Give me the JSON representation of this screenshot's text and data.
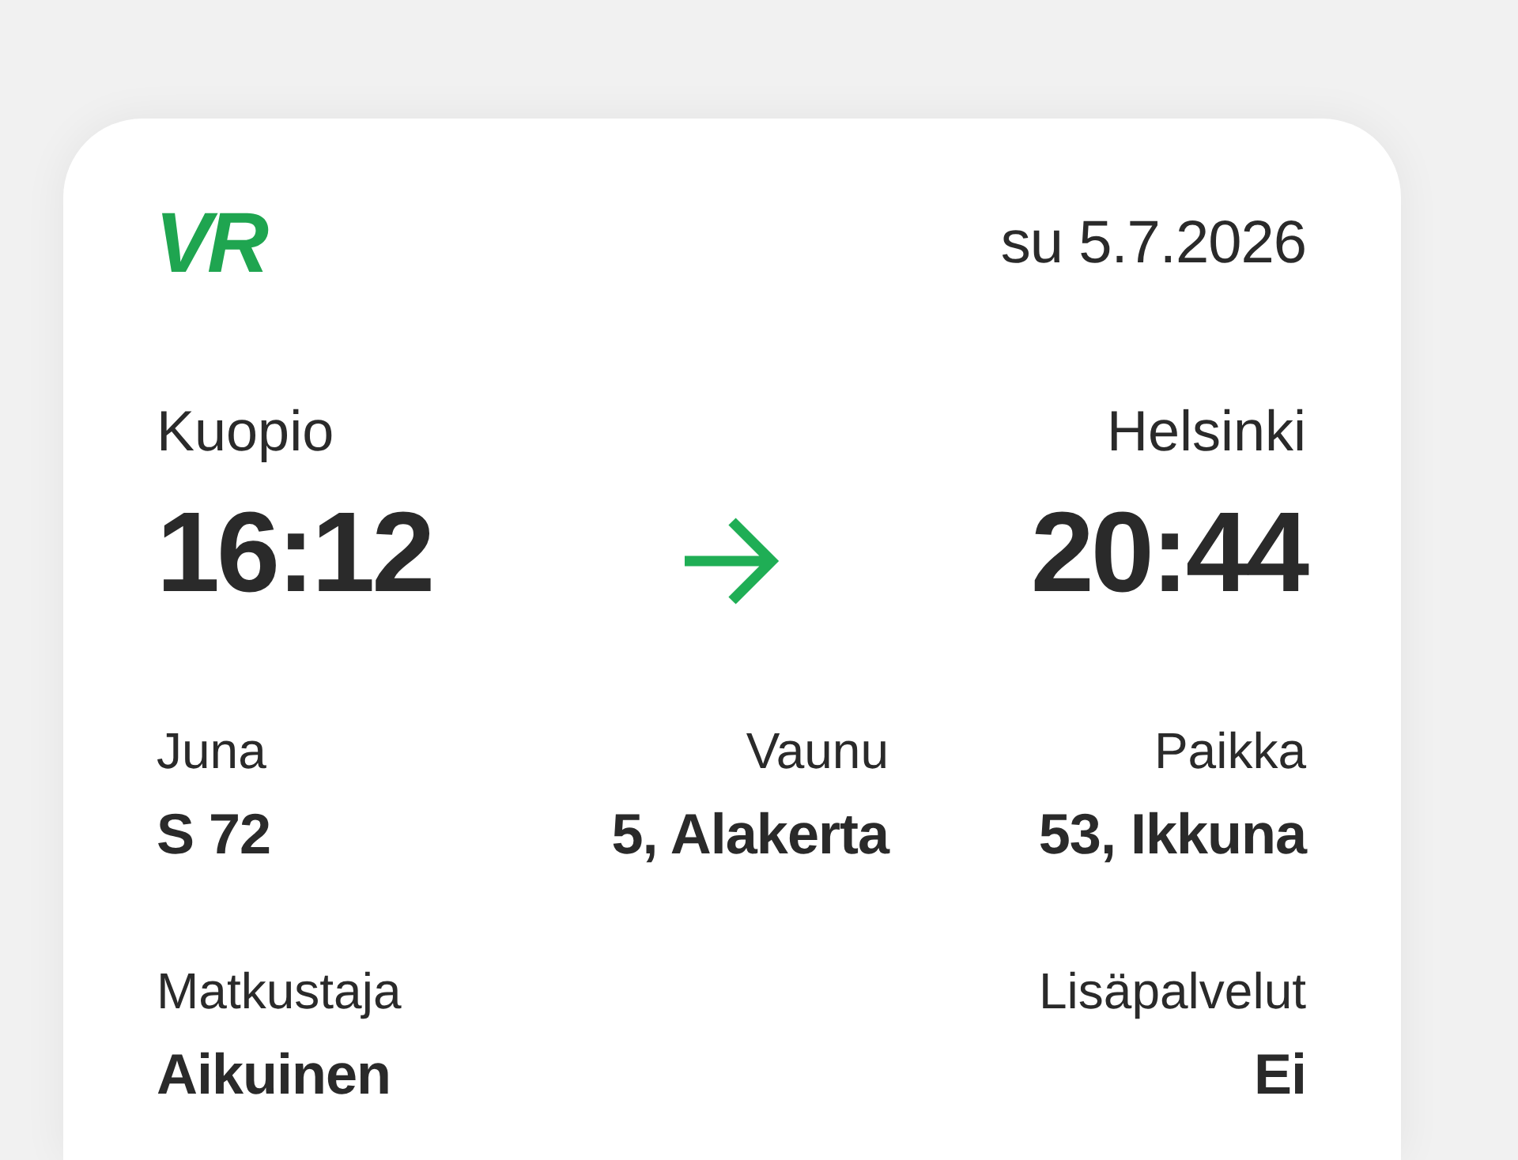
{
  "header": {
    "logo": "VR",
    "date": "su 5.7.2026"
  },
  "journey": {
    "departure": {
      "station": "Kuopio",
      "time": "16:12"
    },
    "arrival": {
      "station": "Helsinki",
      "time": "20:44"
    }
  },
  "details": [
    {
      "label": "Juna",
      "value": "S 72"
    },
    {
      "label": "Vaunu",
      "value": "5, Alakerta"
    },
    {
      "label": "Paikka",
      "value": "53, Ikkuna"
    }
  ],
  "passenger": [
    {
      "label": "Matkustaja",
      "value": "Aikuinen"
    },
    {
      "label": "Lisäpalvelut",
      "value": "Ei"
    }
  ]
}
